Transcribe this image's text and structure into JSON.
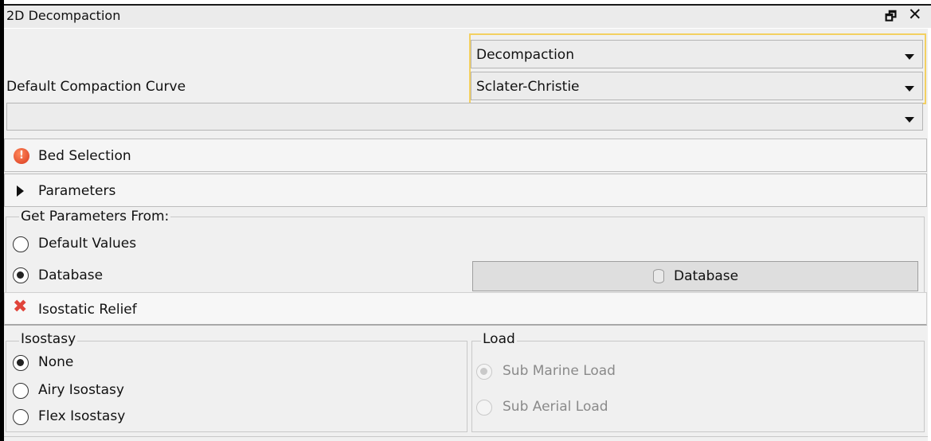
{
  "window": {
    "title": "2D Decompaction",
    "dock_icon": "restore-dock-icon",
    "close_icon": "close-icon"
  },
  "mode_combo": {
    "value": "Decompaction"
  },
  "compaction_curve": {
    "label": "Default Compaction Curve",
    "value": "Sclater-Christie"
  },
  "empty_combo": {
    "value": ""
  },
  "sections": {
    "bed_selection": {
      "label": "Bed Selection",
      "icon": "warning-icon",
      "status_color": "#d9381e"
    },
    "parameters": {
      "label": "Parameters",
      "icon": "expand-arrow-icon"
    },
    "isostatic_relief": {
      "label": "Isostatic Relief",
      "icon": "red-x-icon",
      "status_color": "#e0443a"
    }
  },
  "get_parameters": {
    "title": "Get Parameters From:",
    "options": [
      {
        "label": "Default Values",
        "checked": false
      },
      {
        "label": "Database",
        "checked": true
      }
    ],
    "database_button": {
      "label": "Database",
      "icon": "database-icon"
    }
  },
  "isostasy": {
    "title": "Isostasy",
    "options": [
      {
        "label": "None",
        "checked": true
      },
      {
        "label": "Airy Isostasy",
        "checked": false
      },
      {
        "label": "Flex Isostasy",
        "checked": false
      }
    ]
  },
  "load": {
    "title": "Load",
    "options": [
      {
        "label": "Sub Marine Load",
        "checked": true,
        "disabled": true
      },
      {
        "label": "Sub Aerial Load",
        "checked": false,
        "disabled": true
      }
    ]
  },
  "colors": {
    "highlight": "#f3d061",
    "panel": "#f0f0f0"
  }
}
